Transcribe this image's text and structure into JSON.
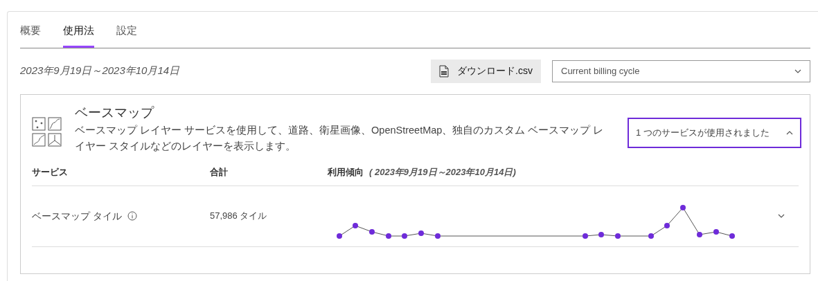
{
  "tabs": [
    {
      "label": "概要",
      "selected": false
    },
    {
      "label": "使用法",
      "selected": true
    },
    {
      "label": "設定",
      "selected": false
    }
  ],
  "date_range": "2023年9月19日～2023年10月14日",
  "download_button": "ダウンロード.csv",
  "period_select": {
    "value": "Current billing cycle"
  },
  "basemap_card": {
    "title": "ベースマップ",
    "description": "ベースマップ レイヤー サービスを使用して、道路、衛星画像、OpenStreetMap、独自のカスタム ベースマップ レイヤー スタイルなどのレイヤーを表示します。",
    "services_toggle": {
      "label": "1 つのサービスが使用されました",
      "expanded": true
    },
    "table": {
      "columns": [
        {
          "label": "サービス"
        },
        {
          "label": "合計"
        },
        {
          "label": "利用傾向",
          "note": "( 2023年9月19日～2023年10月14日)"
        }
      ],
      "rows": [
        {
          "service": "ベースマップ タイル",
          "total": "57,986 タイル",
          "expanded": false
        }
      ]
    }
  }
}
